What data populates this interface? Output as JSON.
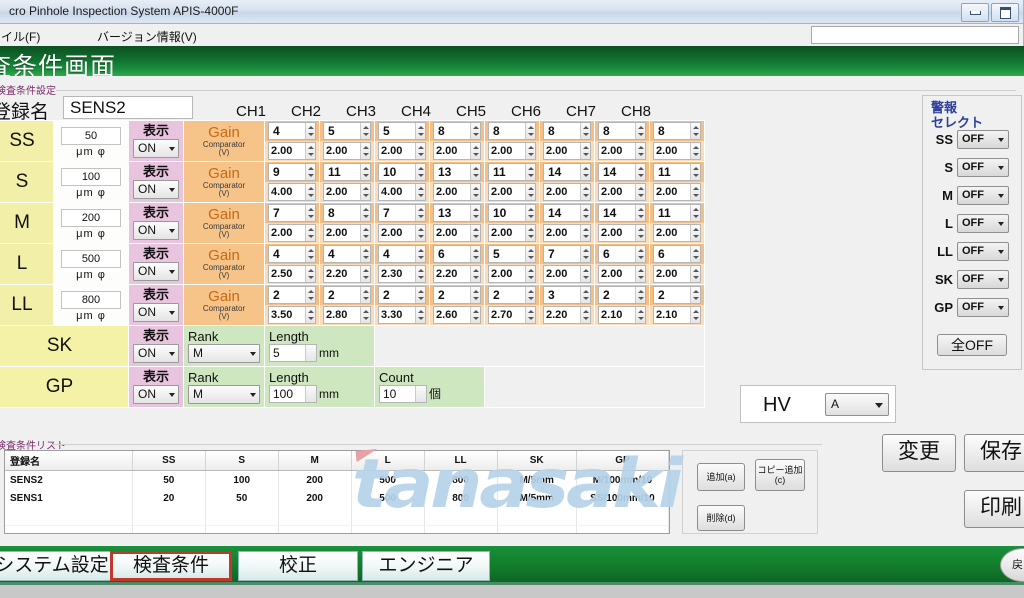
{
  "window": {
    "title": "cro Pinhole Inspection System APIS-4000F",
    "menu": [
      "イル(F)",
      "バージョン情報(V)"
    ],
    "controls": [
      "minimize-icon",
      "maximize-icon"
    ]
  },
  "header": {
    "title": "査条件画面",
    "group_label": "検査条件設定",
    "regname_label": "登録名",
    "regname_value": "SENS2"
  },
  "table": {
    "channel_headers": [
      "CH1",
      "CH2",
      "CH3",
      "CH4",
      "CH5",
      "CH6",
      "CH7",
      "CH8"
    ],
    "display_label": "表示",
    "gain_label": "Gain",
    "comparator_label": "Comparator\n(V)",
    "unit_diameter": "μm φ",
    "rows": [
      {
        "name": "SS",
        "diameter": "50",
        "display": "ON",
        "gain": [
          "4",
          "5",
          "5",
          "8",
          "8",
          "8",
          "8",
          "8"
        ],
        "comparator": [
          "2.00",
          "2.00",
          "2.00",
          "2.00",
          "2.00",
          "2.00",
          "2.00",
          "2.00"
        ]
      },
      {
        "name": "S",
        "diameter": "100",
        "display": "ON",
        "gain": [
          "9",
          "11",
          "10",
          "13",
          "11",
          "14",
          "14",
          "11"
        ],
        "comparator": [
          "4.00",
          "2.00",
          "4.00",
          "2.00",
          "2.00",
          "2.00",
          "2.00",
          "2.00"
        ]
      },
      {
        "name": "M",
        "diameter": "200",
        "display": "ON",
        "gain": [
          "7",
          "8",
          "7",
          "13",
          "10",
          "14",
          "14",
          "11"
        ],
        "comparator": [
          "2.00",
          "2.00",
          "2.00",
          "2.00",
          "2.00",
          "2.00",
          "2.00",
          "2.00"
        ]
      },
      {
        "name": "L",
        "diameter": "500",
        "display": "ON",
        "gain": [
          "4",
          "4",
          "4",
          "6",
          "5",
          "7",
          "6",
          "6"
        ],
        "comparator": [
          "2.50",
          "2.20",
          "2.30",
          "2.20",
          "2.00",
          "2.00",
          "2.00",
          "2.00"
        ]
      },
      {
        "name": "LL",
        "diameter": "800",
        "display": "ON",
        "gain": [
          "2",
          "2",
          "2",
          "2",
          "2",
          "3",
          "2",
          "2"
        ],
        "comparator": [
          "3.50",
          "2.80",
          "3.30",
          "2.60",
          "2.70",
          "2.20",
          "2.10",
          "2.10"
        ]
      }
    ],
    "sk": {
      "name": "SK",
      "display_label": "表示",
      "display": "ON",
      "rank_label": "Rank",
      "rank": "M",
      "length_label": "Length",
      "length": "5",
      "length_unit": "mm"
    },
    "gp": {
      "name": "GP",
      "display_label": "表示",
      "display": "ON",
      "rank_label": "Rank",
      "rank": "M",
      "length_label": "Length",
      "length": "100",
      "length_unit": "mm",
      "count_label": "Count",
      "count": "10",
      "count_unit": "個"
    }
  },
  "alarm": {
    "title_line1": "警報",
    "title_line2": "セレクト",
    "items": [
      {
        "name": "SS",
        "value": "OFF"
      },
      {
        "name": "S",
        "value": "OFF"
      },
      {
        "name": "M",
        "value": "OFF"
      },
      {
        "name": "L",
        "value": "OFF"
      },
      {
        "name": "LL",
        "value": "OFF"
      },
      {
        "name": "SK",
        "value": "OFF"
      },
      {
        "name": "GP",
        "value": "OFF"
      }
    ],
    "all_off_label": "全OFF"
  },
  "hv": {
    "label": "HV",
    "value": "A"
  },
  "list": {
    "group_label": "検査条件リスト",
    "columns": [
      "登録名",
      "SS",
      "S",
      "M",
      "L",
      "LL",
      "SK",
      "GP"
    ],
    "rows": [
      [
        "SENS2",
        "50",
        "100",
        "200",
        "500",
        "800",
        "M/5mm",
        "M/100mm/10"
      ],
      [
        "SENS1",
        "20",
        "50",
        "200",
        "500",
        "800",
        "M/5mm",
        "SS/100mm/10"
      ]
    ],
    "empty_rows": 3
  },
  "list_buttons": {
    "add": "追加(a)",
    "copy_add_line1": "コピー追加",
    "copy_add_line2": "(c)",
    "delete": "削除(d)"
  },
  "actions": {
    "change": "変更",
    "save": "保存",
    "print": "印刷"
  },
  "watermark": {
    "text": "tanasaki"
  },
  "footer": {
    "tabs": [
      {
        "label": "システム設定",
        "active": false
      },
      {
        "label": "検査条件",
        "active": true
      },
      {
        "label": "校正",
        "active": false
      },
      {
        "label": "エンジニア",
        "active": false
      }
    ],
    "back_label": "戻る"
  },
  "colors": {
    "banner_green": "#11702f",
    "row_label_yellow": "#f2f0a8",
    "display_pink": "#e8c4de",
    "gain_orange": "#f6c389",
    "comparator_orange": "#fbdcba",
    "green_cell": "#cfe7c0",
    "active_tab_border": "#c0392b",
    "alarm_title_blue": "#2b3f9e",
    "watermark_blue": "#b6d3ea"
  }
}
